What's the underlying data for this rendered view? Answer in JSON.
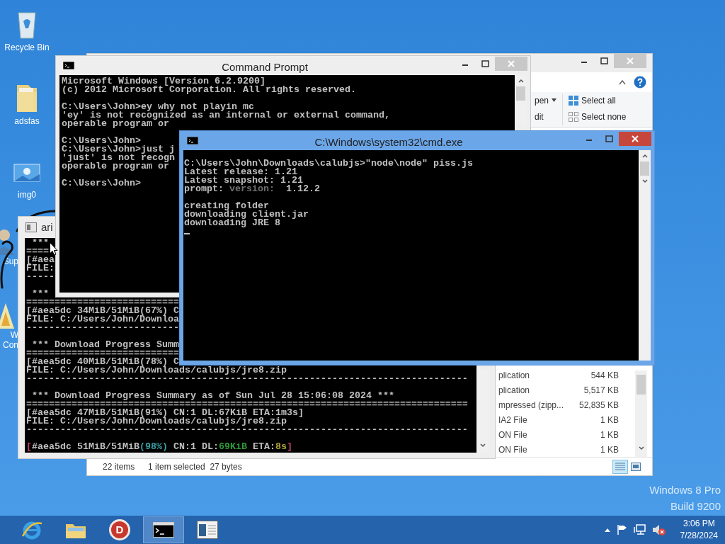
{
  "desktop": {
    "icons": [
      {
        "kind": "recycle",
        "label": "Recycle Bin",
        "clipped": false
      },
      {
        "kind": "folder",
        "label": "adsfas",
        "clipped": false
      },
      {
        "kind": "image",
        "label": "img0",
        "clipped": false
      },
      {
        "kind": "user",
        "label": "Sup",
        "clipped": true
      },
      {
        "kind": "app",
        "label": "W\nCon",
        "clipped": true
      }
    ],
    "edition": "Windows 8 Pro",
    "build": "Build 9200"
  },
  "explorer": {
    "active": false,
    "ribbon": {
      "open": "pen",
      "edit": "dit",
      "select_all": "Select all",
      "select_none": "Select none"
    },
    "files": [
      {
        "type": "plication",
        "size": "544 KB"
      },
      {
        "type": "plication",
        "size": "5,517 KB"
      },
      {
        "type": "mpressed (zipp...",
        "size": "52,835 KB"
      },
      {
        "type": "IA2 File",
        "size": "1 KB"
      },
      {
        "type": "ON File",
        "size": "1 KB"
      },
      {
        "type": "ON File",
        "size": "1 KB"
      }
    ],
    "status": {
      "items": "22 items",
      "selection": "1 item selected  27 bytes"
    },
    "views": [
      {
        "kind": "details",
        "selected": true
      },
      {
        "kind": "large-icons",
        "selected": false
      }
    ]
  },
  "aria": {
    "title": "ari",
    "active": false,
    "blocks": [
      [
        " ***",
        "====",
        "[#aea",
        "FILE:",
        "-----"
      ],
      [
        " ***",
        "===========================",
        "[#aea5dc 34MiB/51MiB(67%) C",
        "FILE: C:/Users/John/Downloa",
        "---------------------------"
      ],
      [
        " *** Download Progress Summ",
        "===========================",
        "[#aea5dc 40MiB/51MiB(78%) C",
        "FILE: C:/Users/John/Downloads/calubjs/jre8.zip",
        "------------------------------------------------------------------------------"
      ],
      [
        " *** Download Progress Summary as of Sun Jul 28 15:06:08 2024 ***",
        "==============================================================================",
        "[#aea5dc 47MiB/51MiB(91%) CN:1 DL:67KiB ETA:1m3s]",
        "FILE: C:/Users/John/Downloads/calubjs/jre8.zip",
        "------------------------------------------------------------------------------"
      ],
      [
        {
          "segments": [
            {
              "text": "[",
              "color": "#c0406a"
            },
            {
              "text": "#aea5dc 51MiB/51MiB",
              "color": "#c0c0c0"
            },
            {
              "text": "(98%)",
              "color": "#3a9fa5"
            },
            {
              "text": " CN:1 DL:",
              "color": "#c0c0c0"
            },
            {
              "text": "69KiB",
              "color": "#2f9a3a"
            },
            {
              "text": " ETA:",
              "color": "#c0c0c0"
            },
            {
              "text": "8s",
              "color": "#b0a432"
            },
            {
              "text": "]",
              "color": "#c0406a"
            }
          ]
        }
      ]
    ]
  },
  "command_prompt": {
    "title": "Command Prompt",
    "active": false,
    "blocks": [
      [
        "Microsoft Windows [Version 6.2.9200]",
        "(c) 2012 Microsoft Corporation. All rights reserved."
      ],
      [
        "C:\\Users\\John>ey why not playin mc",
        "'ey' is not recognized as an internal or external command,",
        "operable program or"
      ],
      [
        "C:\\Users\\John>",
        "C:\\Users\\John>just j",
        "'just' is not recogn",
        "operable program or"
      ],
      [
        "C:\\Users\\John>"
      ]
    ]
  },
  "cmd_exe": {
    "title": "C:\\Windows\\system32\\cmd.exe",
    "active": true,
    "cursor_visible": true,
    "blocks": [
      [
        "C:\\Users\\John\\Downloads\\calubjs>\"node\\node\" piss.js",
        "Latest release: 1.21",
        "Latest snapshot: 1.21",
        {
          "segments": [
            {
              "text": "prompt: ",
              "color": "#c0c0c0"
            },
            {
              "text": "version:",
              "color": "#707070"
            },
            {
              "text": "  1.12.2",
              "color": "#c0c0c0"
            }
          ]
        }
      ],
      [
        "creating folder",
        "downloading client.jar",
        "downloading JRE 8"
      ]
    ]
  },
  "taskbar": {
    "items": [
      {
        "kind": "ie",
        "selected": false
      },
      {
        "kind": "explorer",
        "selected": false
      },
      {
        "kind": "app",
        "glyph": "D",
        "selected": false
      },
      {
        "kind": "cmd",
        "selected": true
      },
      {
        "kind": "window",
        "selected": false
      }
    ],
    "tray": [
      {
        "kind": "caret"
      },
      {
        "kind": "flag"
      },
      {
        "kind": "network"
      },
      {
        "kind": "volume-muted"
      }
    ],
    "clock": {
      "time": "3:06 PM",
      "date": "7/28/2024"
    }
  }
}
